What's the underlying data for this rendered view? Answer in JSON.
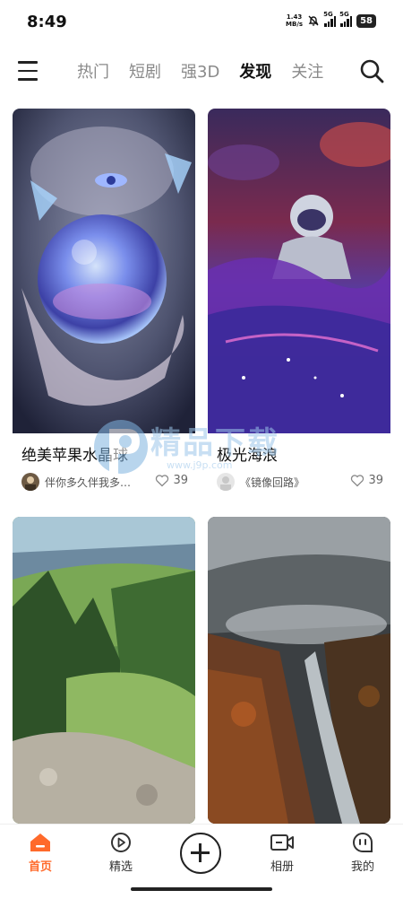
{
  "status_bar": {
    "time": "8:49",
    "net_speed_value": "1.43",
    "net_speed_unit": "MB/s",
    "sim1": "5G",
    "sim2": "5G",
    "battery": "58"
  },
  "header": {
    "menu_icon": "hamburger-menu-icon",
    "tabs": [
      {
        "label": "热门",
        "active": false
      },
      {
        "label": "短剧",
        "active": false
      },
      {
        "label": "强3D",
        "active": false
      },
      {
        "label": "发现",
        "active": true
      },
      {
        "label": "关注",
        "active": false
      }
    ],
    "search_icon": "search-icon"
  },
  "feed": {
    "cards": [
      {
        "title": "绝美苹果水晶球",
        "author": "伴你多久伴我多…",
        "likes": "39"
      },
      {
        "title": "极光海浪",
        "author": "《镜像回路》",
        "likes": "39"
      },
      {
        "title": "",
        "author": "",
        "likes": ""
      },
      {
        "title": "",
        "author": "",
        "likes": ""
      }
    ]
  },
  "watermark": {
    "text": "精品下载",
    "url": "www.j9p.com"
  },
  "bottom_nav": {
    "items": [
      {
        "label": "首页",
        "icon": "home-icon",
        "active": true
      },
      {
        "label": "精选",
        "icon": "play-circle-icon",
        "active": false
      },
      {
        "label": "",
        "icon": "add-icon",
        "active": false
      },
      {
        "label": "相册",
        "icon": "video-camera-icon",
        "active": false
      },
      {
        "label": "我的",
        "icon": "profile-face-icon",
        "active": false
      }
    ]
  },
  "colors": {
    "accent": "#ff6a2b",
    "text": "#111111",
    "muted": "#8a8a8a"
  }
}
